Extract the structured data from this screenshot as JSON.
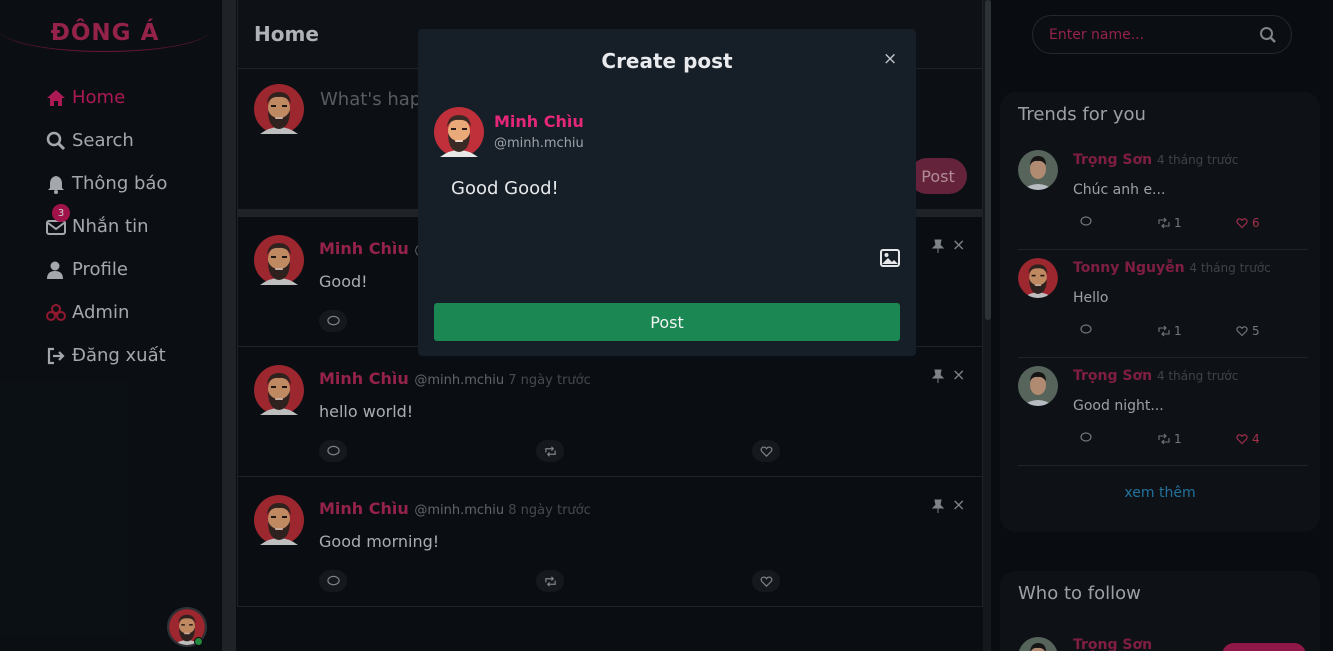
{
  "logo": "ĐÔNG Á",
  "nav": [
    {
      "label": "Home",
      "icon": "home-icon",
      "active": true
    },
    {
      "label": "Search",
      "icon": "search-icon"
    },
    {
      "label": "Thông báo",
      "icon": "bell-icon"
    },
    {
      "label": "Nhắn tin",
      "icon": "mail-icon",
      "badge": "3"
    },
    {
      "label": "Profile",
      "icon": "user-icon"
    },
    {
      "label": "Admin",
      "icon": "biohazard-icon"
    },
    {
      "label": "Đăng xuất",
      "icon": "logout-icon"
    }
  ],
  "feed": {
    "title": "Home",
    "composer_placeholder": "What's happ",
    "composer_post": "Post",
    "posts": [
      {
        "name": "Minh Chìu",
        "handle": "@",
        "time": "",
        "text": "Good!"
      },
      {
        "name": "Minh Chìu",
        "handle": "@minh.mchiu",
        "time": "7 ngày trước",
        "text": "hello world!"
      },
      {
        "name": "Minh Chìu",
        "handle": "@minh.mchiu",
        "time": "8 ngày trước",
        "text": "Good morning!"
      }
    ]
  },
  "search": {
    "placeholder": "Enter name..."
  },
  "trends": {
    "title": "Trends for you",
    "items": [
      {
        "name": "Trọng Sơn",
        "time": "4 tháng trước",
        "text": "Chúc anh e...",
        "retweets": "1",
        "likes": "6"
      },
      {
        "name": "Tonny Nguyễn",
        "time": "4 tháng trước",
        "text": "Hello",
        "retweets": "1",
        "likes": "5"
      },
      {
        "name": "Trọng Sơn",
        "time": "4 tháng trước",
        "text": "Good night...",
        "retweets": "1",
        "likes": "4"
      }
    ],
    "more": "xem thêm"
  },
  "follow": {
    "title": "Who to follow",
    "first_name": "Trọng Sơn"
  },
  "modal": {
    "title": "Create post",
    "close": "×",
    "name": "Minh Chìu",
    "handle": "@minh.mchiu",
    "text": "Good Good!",
    "post_label": "Post"
  },
  "colors": {
    "accent": "#d21f68",
    "post_button": "#1b8752",
    "background": "#0d1117"
  }
}
